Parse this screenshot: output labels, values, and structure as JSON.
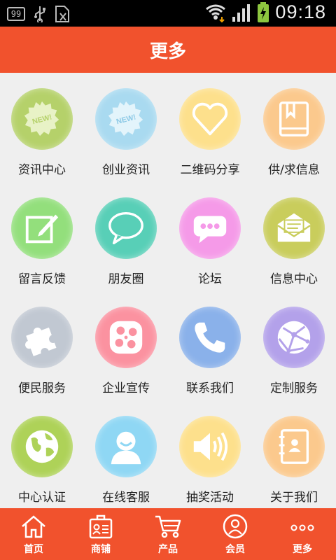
{
  "status_bar": {
    "badge": "99",
    "time": "09:18",
    "icons": [
      "notification-99-icon",
      "usb-icon",
      "sim-icon",
      "wifi-icon",
      "signal-icon",
      "battery-charging-icon"
    ]
  },
  "header": {
    "title": "更多"
  },
  "grid": {
    "items": [
      {
        "label": "资讯中心",
        "icon": "new-badge-icon",
        "color": "#b5d16a"
      },
      {
        "label": "创业资讯",
        "icon": "new-badge-icon",
        "color": "#a9daf0"
      },
      {
        "label": "二维码分享",
        "icon": "heart-icon",
        "color": "#fde08c"
      },
      {
        "label": "供/求信息",
        "icon": "book-icon",
        "color": "#fbc98d"
      },
      {
        "label": "留言反馈",
        "icon": "edit-note-icon",
        "color": "#93df7c"
      },
      {
        "label": "朋友圈",
        "icon": "chat-bubble-icon",
        "color": "#58cfb7"
      },
      {
        "label": "论坛",
        "icon": "speech-dots-icon",
        "color": "#f59ae8"
      },
      {
        "label": "信息中心",
        "icon": "envelope-icon",
        "color": "#c9cd5c"
      },
      {
        "label": "便民服务",
        "icon": "puzzle-icon",
        "color": "#c1c8d2"
      },
      {
        "label": "企业宣传",
        "icon": "film-reel-icon",
        "color": "#fb92a0"
      },
      {
        "label": "联系我们",
        "icon": "phone-icon",
        "color": "#8ab1ea"
      },
      {
        "label": "定制服务",
        "icon": "network-globe-icon",
        "color": "#b3a1ea"
      },
      {
        "label": "中心认证",
        "icon": "globe-icon",
        "color": "#aed258"
      },
      {
        "label": "在线客服",
        "icon": "user-avatar-icon",
        "color": "#8fd7f4"
      },
      {
        "label": "抽奖活动",
        "icon": "speaker-icon",
        "color": "#fde08c"
      },
      {
        "label": "关于我们",
        "icon": "contacts-book-icon",
        "color": "#fbc98d"
      }
    ]
  },
  "bottom_nav": {
    "items": [
      {
        "label": "首页",
        "icon": "home-icon"
      },
      {
        "label": "商铺",
        "icon": "shop-id-icon"
      },
      {
        "label": "产品",
        "icon": "cart-icon"
      },
      {
        "label": "会员",
        "icon": "member-icon"
      },
      {
        "label": "更多",
        "icon": "more-dots-icon"
      }
    ]
  },
  "colors": {
    "accent": "#f1522d",
    "background": "#efefef"
  }
}
